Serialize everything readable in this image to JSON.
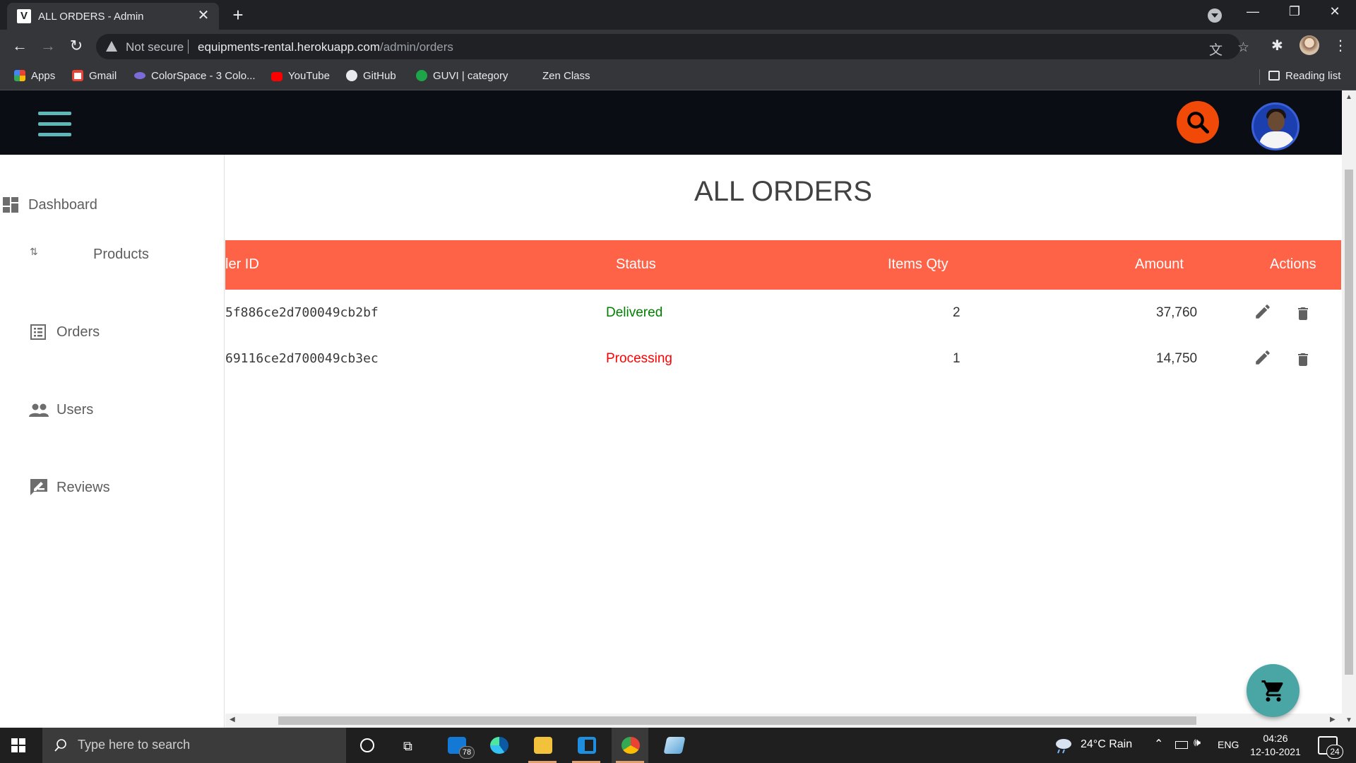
{
  "browser": {
    "tab_title": "ALL ORDERS - Admin",
    "tab_icon": "V",
    "security_label": "Not secure",
    "url_host": "equipments-rental.herokuapp.com",
    "url_path": "/admin/orders",
    "bookmarks": [
      {
        "label": "Apps",
        "icon": "apps-grid-icon"
      },
      {
        "label": "Gmail",
        "icon": "gmail-icon"
      },
      {
        "label": "ColorSpace - 3 Colo...",
        "icon": "colorspace-icon"
      },
      {
        "label": "YouTube",
        "icon": "youtube-icon"
      },
      {
        "label": "GitHub",
        "icon": "github-icon"
      },
      {
        "label": "GUVI | category",
        "icon": "guvi-icon"
      },
      {
        "label": "Zen Class",
        "icon": "zen-icon"
      }
    ],
    "reading_list": "Reading list"
  },
  "header": {
    "accent_color": "#f14907",
    "bar_color": "#0a0d13",
    "menu_color": "#5fb8b8"
  },
  "sidebar": {
    "items": [
      {
        "label": "Dashboard",
        "icon": "dashboard-icon"
      },
      {
        "label": "Products",
        "icon": "sort-arrows-icon"
      },
      {
        "label": "Orders",
        "icon": "list-alt-icon"
      },
      {
        "label": "Users",
        "icon": "people-icon"
      },
      {
        "label": "Reviews",
        "icon": "rate-review-icon"
      }
    ]
  },
  "main": {
    "title": "ALL ORDERS",
    "table": {
      "header_color": "#ff6347",
      "columns": [
        "ler ID",
        "Status",
        "Items Qty",
        "Amount",
        "Actions"
      ],
      "rows": [
        {
          "order_id": "5f886ce2d700049cb2bf",
          "status": "Delivered",
          "status_color": "#008000",
          "qty": "2",
          "amount": "37,760"
        },
        {
          "order_id": "69116ce2d700049cb3ec",
          "status": "Processing",
          "status_color": "#ff0000",
          "qty": "1",
          "amount": "14,750"
        }
      ]
    }
  },
  "taskbar": {
    "search_placeholder": "Type here to search",
    "mail_badge": "78",
    "weather": "24°C Rain",
    "language": "ENG",
    "time": "04:26",
    "date": "12-10-2021",
    "notifications": "24"
  }
}
